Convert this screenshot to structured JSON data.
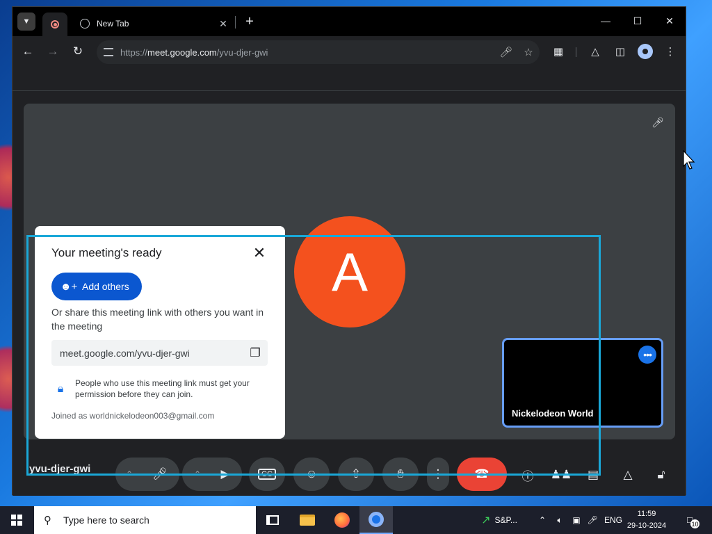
{
  "browser": {
    "tab_title": "New Tab",
    "url_prefix": "https://",
    "url_host": "meet.google.com",
    "url_path": "/yvu-djer-gwi"
  },
  "meet": {
    "participant_initial": "A",
    "self_tile_name": "Nickelodeon World",
    "meeting_code": "yvu-djer-gwi"
  },
  "dialog": {
    "title": "Your meeting's ready",
    "add_others_label": "Add others",
    "share_text": "Or share this meeting link with others you want in the meeting",
    "meeting_link": "meet.google.com/yvu-djer-gwi",
    "permission_text": "People who use this meeting link must get your permission before they can join.",
    "joined_as": "Joined as worldnickelodeon003@gmail.com"
  },
  "taskbar": {
    "search_placeholder": "Type here to search",
    "stock_label": "S&P...",
    "language": "ENG",
    "time": "11:59",
    "date": "29-10-2024",
    "notification_count": "10"
  },
  "colors": {
    "avatar_bg": "#f4511e",
    "hangup": "#ea4335",
    "primary_button": "#0b57d0",
    "highlight_box": "#1aa8d8"
  }
}
